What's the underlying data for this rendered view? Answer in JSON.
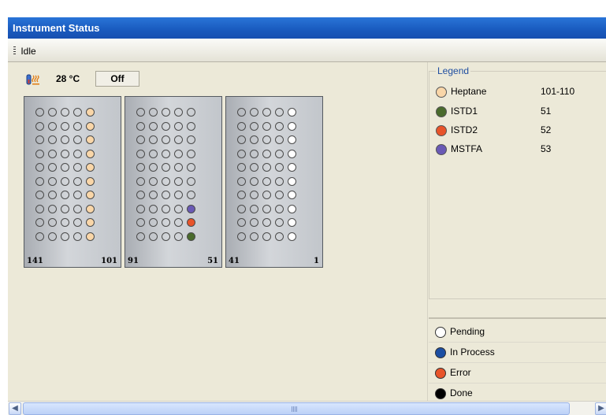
{
  "window": {
    "title": "Instrument Status"
  },
  "toolbar": {
    "status": "Idle"
  },
  "heater": {
    "icon": "heater-icon",
    "temperature": "28 °C",
    "state": "Off"
  },
  "colors": {
    "heptane": "#f9d6a8",
    "istd1": "#4a6b2c",
    "istd2": "#e8542a",
    "mstfa": "#6a5ab5",
    "pending": "#ffffff",
    "in_process": "#1c4fa3",
    "error": "#e8542a",
    "done": "#000000"
  },
  "trays": [
    {
      "label_left": "141",
      "label_right": "101",
      "rows": [
        [
          "empty",
          "empty",
          "empty",
          "empty",
          "heptane"
        ],
        [
          "empty",
          "empty",
          "empty",
          "empty",
          "heptane"
        ],
        [
          "empty",
          "empty",
          "empty",
          "empty",
          "heptane"
        ],
        [
          "empty",
          "empty",
          "empty",
          "empty",
          "heptane"
        ],
        [
          "empty",
          "empty",
          "empty",
          "empty",
          "heptane"
        ],
        [
          "empty",
          "empty",
          "empty",
          "empty",
          "heptane"
        ],
        [
          "empty",
          "empty",
          "empty",
          "empty",
          "heptane"
        ],
        [
          "empty",
          "empty",
          "empty",
          "empty",
          "heptane"
        ],
        [
          "empty",
          "empty",
          "empty",
          "empty",
          "heptane"
        ],
        [
          "empty",
          "empty",
          "empty",
          "empty",
          "heptane"
        ]
      ]
    },
    {
      "label_left": "91",
      "label_right": "51",
      "rows": [
        [
          "empty",
          "empty",
          "empty",
          "empty",
          "empty"
        ],
        [
          "empty",
          "empty",
          "empty",
          "empty",
          "empty"
        ],
        [
          "empty",
          "empty",
          "empty",
          "empty",
          "empty"
        ],
        [
          "empty",
          "empty",
          "empty",
          "empty",
          "empty"
        ],
        [
          "empty",
          "empty",
          "empty",
          "empty",
          "empty"
        ],
        [
          "empty",
          "empty",
          "empty",
          "empty",
          "empty"
        ],
        [
          "empty",
          "empty",
          "empty",
          "empty",
          "empty"
        ],
        [
          "empty",
          "empty",
          "empty",
          "empty",
          "mstfa"
        ],
        [
          "empty",
          "empty",
          "empty",
          "empty",
          "istd2"
        ],
        [
          "empty",
          "empty",
          "empty",
          "empty",
          "istd1"
        ]
      ]
    },
    {
      "label_left": "41",
      "label_right": "1",
      "rows": [
        [
          "empty",
          "empty",
          "empty",
          "empty",
          "pending"
        ],
        [
          "empty",
          "empty",
          "empty",
          "empty",
          "pending"
        ],
        [
          "empty",
          "empty",
          "empty",
          "empty",
          "pending"
        ],
        [
          "empty",
          "empty",
          "empty",
          "empty",
          "pending"
        ],
        [
          "empty",
          "empty",
          "empty",
          "empty",
          "pending"
        ],
        [
          "empty",
          "empty",
          "empty",
          "empty",
          "pending"
        ],
        [
          "empty",
          "empty",
          "empty",
          "empty",
          "pending"
        ],
        [
          "empty",
          "empty",
          "empty",
          "empty",
          "pending"
        ],
        [
          "empty",
          "empty",
          "empty",
          "empty",
          "pending"
        ],
        [
          "empty",
          "empty",
          "empty",
          "empty",
          "pending"
        ]
      ]
    }
  ],
  "legend": {
    "title": "Legend",
    "items": [
      {
        "name": "Heptane",
        "positions": "101-110",
        "color": "#f9d6a8"
      },
      {
        "name": "ISTD1",
        "positions": "51",
        "color": "#4a6b2c"
      },
      {
        "name": "ISTD2",
        "positions": "52",
        "color": "#e8542a"
      },
      {
        "name": "MSTFA",
        "positions": "53",
        "color": "#6a5ab5"
      }
    ]
  },
  "status_legend": {
    "items": [
      {
        "name": "Pending",
        "color": "#ffffff"
      },
      {
        "name": "In Process",
        "color": "#1c4fa3"
      },
      {
        "name": "Error",
        "color": "#e8542a"
      },
      {
        "name": "Done",
        "color": "#000000"
      }
    ]
  }
}
